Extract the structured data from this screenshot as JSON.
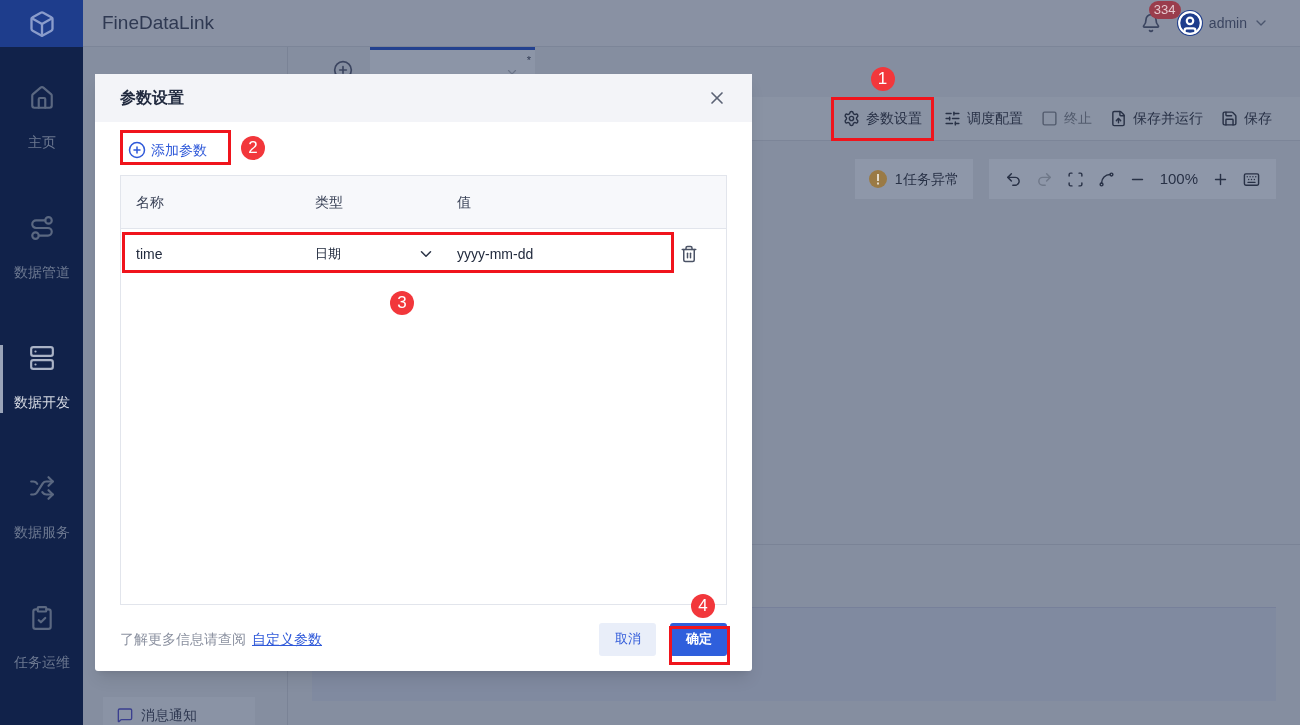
{
  "sidebar": {
    "items": [
      {
        "label": "主页",
        "selected": false
      },
      {
        "label": "数据管道",
        "selected": false
      },
      {
        "label": "数据开发",
        "selected": true
      },
      {
        "label": "数据服务",
        "selected": false
      },
      {
        "label": "任务运维",
        "selected": false
      }
    ]
  },
  "header": {
    "title": "FineDataLink",
    "notification_count": "334",
    "user": "admin"
  },
  "task_panel": {
    "items": [
      {
        "label": "消息通知"
      }
    ]
  },
  "tabs": [
    {
      "modified_mark": "*",
      "selected": true
    }
  ],
  "toolbar": {
    "buttons": [
      {
        "label": "参数设置",
        "disabled": false
      },
      {
        "label": "调度配置",
        "disabled": false
      },
      {
        "label": "终止",
        "disabled": true
      },
      {
        "label": "保存并运行",
        "disabled": false
      },
      {
        "label": "保存",
        "disabled": false
      }
    ]
  },
  "canvas": {
    "warning": "1任务异常",
    "zoom": "100%"
  },
  "dialog": {
    "title": "参数设置",
    "add_button": "添加参数",
    "columns": [
      "名称",
      "类型",
      "值"
    ],
    "rows": [
      {
        "name": "time",
        "type": "日期",
        "value": "yyyy-mm-dd"
      }
    ],
    "help_text": "了解更多信息请查阅",
    "help_link": "自定义参数",
    "buttons": [
      {
        "label": "取消",
        "kind": "secondary"
      },
      {
        "label": "确定",
        "kind": "primary"
      }
    ]
  },
  "annotations": [
    "1",
    "2",
    "3",
    "4"
  ]
}
